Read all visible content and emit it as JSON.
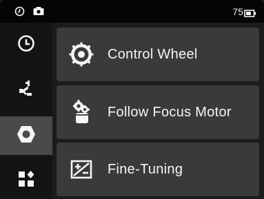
{
  "status_bar": {
    "left_icons": [
      "clock-icon",
      "camera-icon"
    ],
    "battery_level": "75",
    "battery_icon": "battery-icon"
  },
  "sidebar": {
    "items": [
      {
        "name": "history",
        "icon": "clock-icon",
        "active": false
      },
      {
        "name": "stabilizer",
        "icon": "gimbal-arm-icon",
        "active": false
      },
      {
        "name": "accessories",
        "icon": "hexagon-icon",
        "active": true
      },
      {
        "name": "more",
        "icon": "apps-icon",
        "active": false
      }
    ]
  },
  "menu": {
    "items": [
      {
        "label": "Control Wheel",
        "icon": "control-wheel-icon"
      },
      {
        "label": "Follow Focus Motor",
        "icon": "focus-motor-icon"
      },
      {
        "label": "Fine-Tuning",
        "icon": "fine-tuning-icon"
      }
    ]
  },
  "colors": {
    "background": "#1c1c1c",
    "card": "#3a3a3a",
    "active_sidebar": "#4a4a4a",
    "text": "#f5f5f5"
  }
}
